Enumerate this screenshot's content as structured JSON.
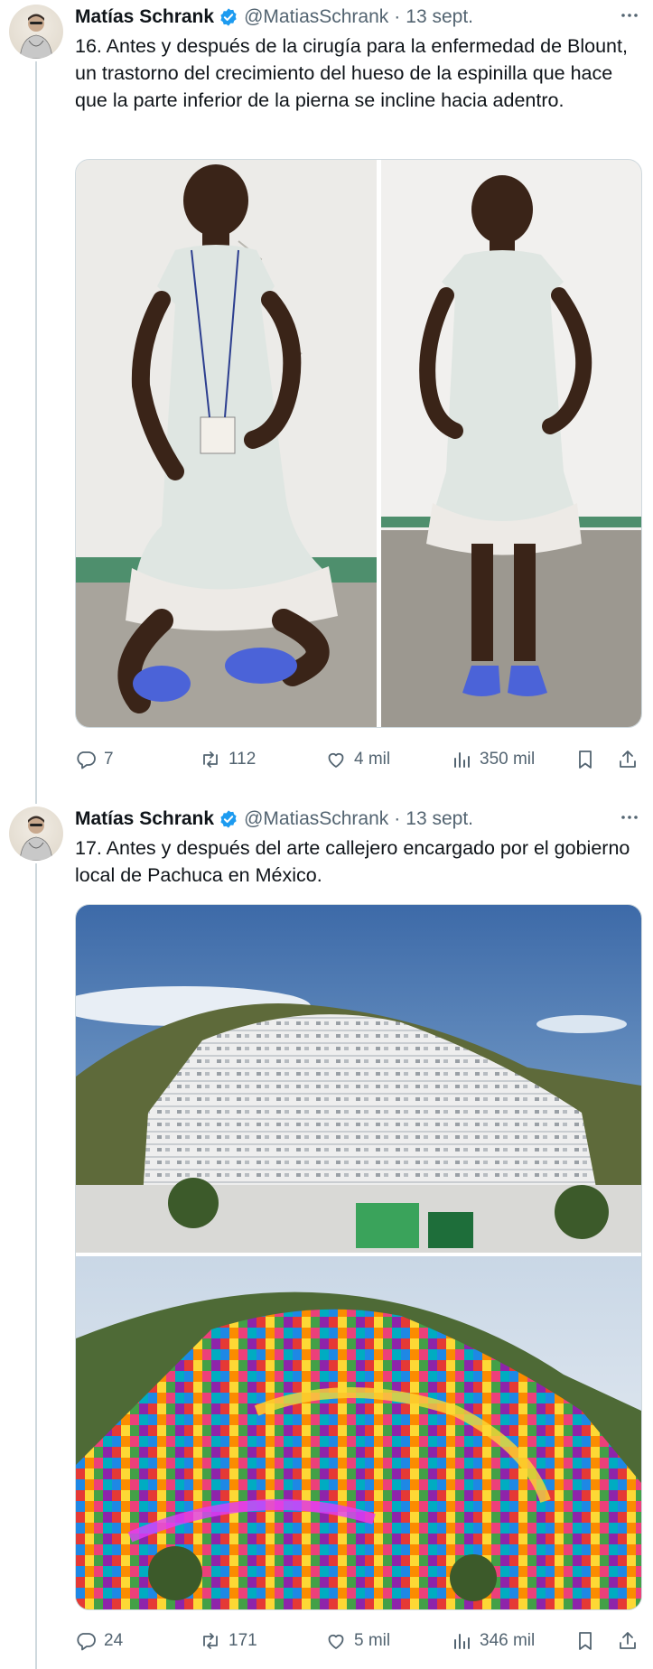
{
  "tweets": [
    {
      "author": {
        "name": "Matías Schrank",
        "handle": "@MatiasSchrank",
        "date": "13 sept."
      },
      "text": "16. Antes y después de la cirugía para la enfermedad de Blount, un trastorno del crecimiento del hueso de la espinilla que hace que la parte inferior de la pierna se incline hacia adentro.",
      "stats": {
        "replies": "7",
        "retweets": "112",
        "likes": "4 mil",
        "views": "350 mil"
      }
    },
    {
      "author": {
        "name": "Matías Schrank",
        "handle": "@MatiasSchrank",
        "date": "13 sept."
      },
      "text": "17. Antes y después del arte callejero encargado por el gobierno local de Pachuca en México.",
      "stats": {
        "replies": "24",
        "retweets": "171",
        "likes": "5 mil",
        "views": "346 mil"
      }
    }
  ],
  "icons": {
    "verified": "verified-badge-icon",
    "more": "more-horizontal-icon",
    "reply": "reply-icon",
    "retweet": "retweet-icon",
    "like": "heart-icon",
    "views": "views-chart-icon",
    "bookmark": "bookmark-icon",
    "share": "share-icon"
  },
  "colors": {
    "verified": "#1d9bf0",
    "secondary_text": "#536471",
    "thread_line": "#cfd9de"
  }
}
